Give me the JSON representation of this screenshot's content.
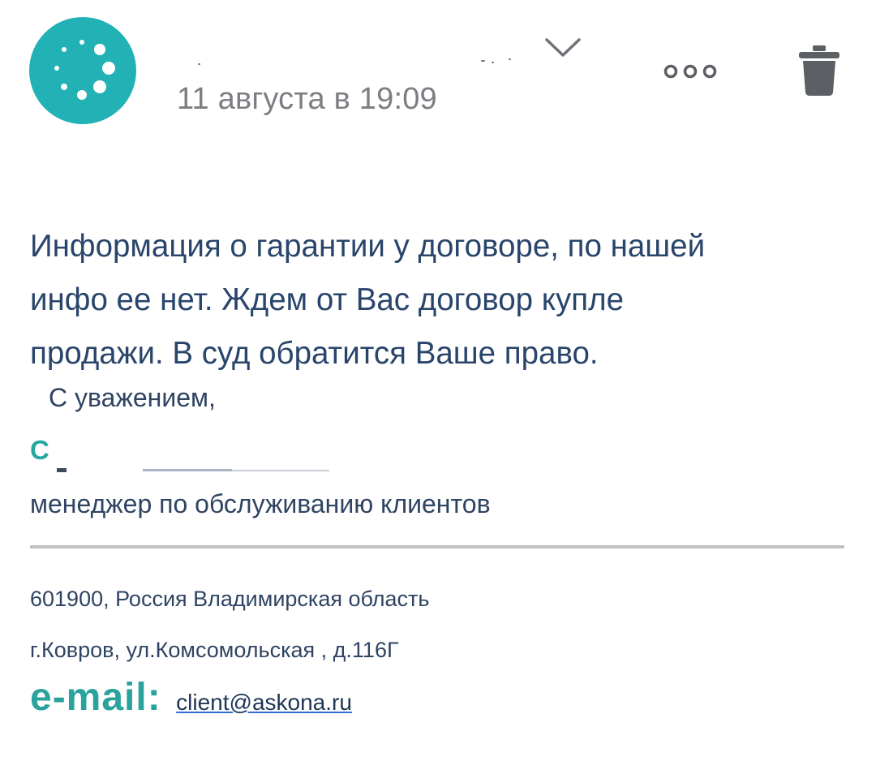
{
  "header": {
    "date": "11 августа в 19:09",
    "avatar_icon": "loading-dots-icon",
    "expand_icon": "chevron-down-icon",
    "more_icon": "more-dots-icon",
    "delete_icon": "trash-icon",
    "avatar_color": "#22b2b5"
  },
  "message": {
    "lines": [
      "Информация о гарантии у договоре, по нашей",
      "инфо ее нет. Ждем от Вас договор купле",
      "продажи. В суд обратится Ваше право."
    ]
  },
  "signature": {
    "regards": "С уважением,",
    "name_initial": "С",
    "position": "менеджер по обслуживанию клиентов",
    "address_line1": "601900, Россия Владимирская область",
    "address_line2": "г.Ковров, ул.Комсомольская , д.116Г",
    "email_label": "e-mail:",
    "email": "client@askona.ru"
  },
  "colors": {
    "text": "#29456b",
    "accent": "#2ba39d",
    "muted": "#7b7e82"
  }
}
